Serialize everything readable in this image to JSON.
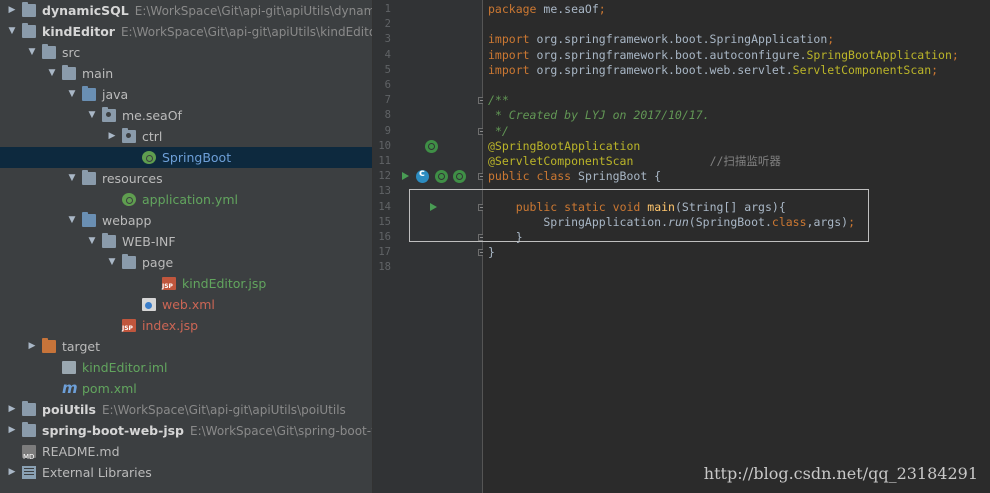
{
  "tree": [
    {
      "label": "dynamicSQL",
      "path": "E:\\WorkSpace\\Git\\api-git\\apiUtils\\dynamic",
      "depth": 0,
      "arrow": "right",
      "icon": "module",
      "style": "bold"
    },
    {
      "label": "kindEditor",
      "path": "E:\\WorkSpace\\Git\\api-git\\apiUtils\\kindEditor",
      "depth": 0,
      "arrow": "down",
      "icon": "module",
      "style": "bold"
    },
    {
      "label": "src",
      "path": "",
      "depth": 1,
      "arrow": "down",
      "icon": "folder",
      "style": ""
    },
    {
      "label": "main",
      "path": "",
      "depth": 2,
      "arrow": "down",
      "icon": "folder",
      "style": ""
    },
    {
      "label": "java",
      "path": "",
      "depth": 3,
      "arrow": "down",
      "icon": "folder-src",
      "style": ""
    },
    {
      "label": "me.seaOf",
      "path": "",
      "depth": 4,
      "arrow": "down",
      "icon": "package",
      "style": ""
    },
    {
      "label": "ctrl",
      "path": "",
      "depth": 5,
      "arrow": "right",
      "icon": "package",
      "style": ""
    },
    {
      "label": "SpringBoot",
      "path": "",
      "depth": 6,
      "arrow": "",
      "icon": "spring-class",
      "style": "blue",
      "selected": true
    },
    {
      "label": "resources",
      "path": "",
      "depth": 3,
      "arrow": "down",
      "icon": "folder-res",
      "style": ""
    },
    {
      "label": "application.yml",
      "path": "",
      "depth": 5,
      "arrow": "",
      "icon": "leaf",
      "style": "green"
    },
    {
      "label": "webapp",
      "path": "",
      "depth": 3,
      "arrow": "down",
      "icon": "folder-web",
      "style": ""
    },
    {
      "label": "WEB-INF",
      "path": "",
      "depth": 4,
      "arrow": "down",
      "icon": "folder",
      "style": ""
    },
    {
      "label": "page",
      "path": "",
      "depth": 5,
      "arrow": "down",
      "icon": "folder",
      "style": ""
    },
    {
      "label": "kindEditor.jsp",
      "path": "",
      "depth": 7,
      "arrow": "",
      "icon": "jsp",
      "style": "green"
    },
    {
      "label": "web.xml",
      "path": "",
      "depth": 6,
      "arrow": "",
      "icon": "xml",
      "style": "red"
    },
    {
      "label": "index.jsp",
      "path": "",
      "depth": 5,
      "arrow": "",
      "icon": "jsp",
      "style": "red"
    },
    {
      "label": "target",
      "path": "",
      "depth": 1,
      "arrow": "right",
      "icon": "folder-orange",
      "style": ""
    },
    {
      "label": "kindEditor.iml",
      "path": "",
      "depth": 2,
      "arrow": "",
      "icon": "file",
      "style": "green"
    },
    {
      "label": "pom.xml",
      "path": "",
      "depth": 2,
      "arrow": "",
      "icon": "maven",
      "style": "green"
    },
    {
      "label": "poiUtils",
      "path": "E:\\WorkSpace\\Git\\api-git\\apiUtils\\poiUtils",
      "depth": 0,
      "arrow": "right",
      "icon": "module",
      "style": "bold"
    },
    {
      "label": "spring-boot-web-jsp",
      "path": "E:\\WorkSpace\\Git\\spring-boot-we",
      "depth": 0,
      "arrow": "right",
      "icon": "module",
      "style": "bold"
    },
    {
      "label": "README.md",
      "path": "",
      "depth": 0,
      "arrow": "",
      "icon": "md",
      "style": ""
    },
    {
      "label": "External Libraries",
      "path": "",
      "depth": 0,
      "arrow": "right",
      "icon": "libs",
      "style": ""
    }
  ],
  "line_numbers": [
    "1",
    "2",
    "3",
    "4",
    "5",
    "6",
    "7",
    "8",
    "9",
    "10",
    "11",
    "12",
    "13",
    "14",
    "15",
    "16",
    "17",
    "18"
  ],
  "code": [
    [
      {
        "t": "package ",
        "c": "kw"
      },
      {
        "t": "me.seaOf",
        "c": ""
      },
      {
        "t": ";",
        "c": "kw"
      }
    ],
    [],
    [
      {
        "t": "import ",
        "c": "kw"
      },
      {
        "t": "org.springframework.boot.SpringApplication",
        "c": ""
      },
      {
        "t": ";",
        "c": "kw"
      }
    ],
    [
      {
        "t": "import ",
        "c": "kw"
      },
      {
        "t": "org.springframework.boot.autoconfigure.",
        "c": ""
      },
      {
        "t": "SpringBootApplication",
        "c": "ann"
      },
      {
        "t": ";",
        "c": "kw"
      }
    ],
    [
      {
        "t": "import ",
        "c": "kw"
      },
      {
        "t": "org.springframework.boot.web.servlet.",
        "c": ""
      },
      {
        "t": "ServletComponentScan",
        "c": "ann"
      },
      {
        "t": ";",
        "c": "kw"
      }
    ],
    [],
    [
      {
        "t": "/**",
        "c": "cm"
      }
    ],
    [
      {
        "t": " * Created by LYJ on 2017/10/17.",
        "c": "cm"
      }
    ],
    [
      {
        "t": " */",
        "c": "cm"
      }
    ],
    [
      {
        "t": "@SpringBootApplication",
        "c": "ann"
      }
    ],
    [
      {
        "t": "@ServletComponentScan",
        "c": "ann"
      },
      {
        "t": "           //扫描监听器",
        "c": "lc"
      }
    ],
    [
      {
        "t": "public ",
        "c": "kw"
      },
      {
        "t": "class ",
        "c": "kw"
      },
      {
        "t": "SpringBoot {",
        "c": ""
      }
    ],
    [],
    [
      {
        "t": "    public ",
        "c": "kw"
      },
      {
        "t": "static ",
        "c": "kw"
      },
      {
        "t": "void ",
        "c": "kw"
      },
      {
        "t": "main",
        "c": "fn"
      },
      {
        "t": "(String[] args){",
        "c": ""
      }
    ],
    [
      {
        "t": "        SpringApplication.",
        "c": ""
      },
      {
        "t": "run",
        "c": "it"
      },
      {
        "t": "(SpringBoot.",
        "c": ""
      },
      {
        "t": "class",
        "c": "kw"
      },
      {
        "t": ",args)",
        "c": ""
      },
      {
        "t": ";",
        "c": "kw"
      }
    ],
    [
      {
        "t": "    }",
        "c": ""
      }
    ],
    [
      {
        "t": "}",
        "c": ""
      }
    ],
    []
  ],
  "watermark": "http://blog.csdn.net/qq_23184291",
  "colors": {
    "keyword": "#cc7832",
    "annotation": "#bbb529",
    "comment": "#629755",
    "selection": "#214283"
  },
  "icons": [
    "module-icon",
    "folder-icon",
    "package-icon",
    "spring-class-icon",
    "leaf-icon",
    "jsp-icon",
    "xml-icon",
    "maven-icon",
    "md-icon",
    "libraries-icon",
    "run-icon",
    "bean-icon",
    "bulb-icon"
  ]
}
